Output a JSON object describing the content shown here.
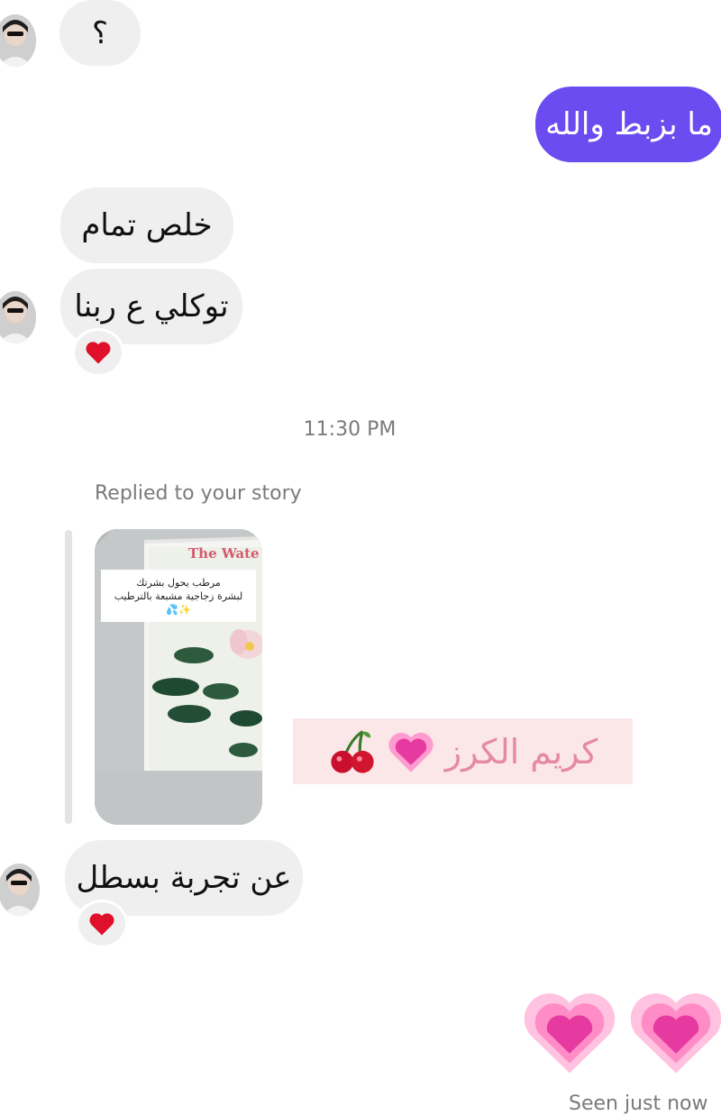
{
  "messages": {
    "question": "؟",
    "sent_reply": "ما بزبط والله",
    "khalas": "خلص تمام",
    "tawakkali": "توكلي ع ربنا",
    "an_tajriba": "عن تجربة بسطل"
  },
  "reactions": {
    "emoji": "heart"
  },
  "timestamp": "11:30 PM",
  "story_reply": {
    "label": "Replied to your story",
    "book_title": "The Wate",
    "caption_line1": "مرطب يحول بشرتك",
    "caption_line2": "لبشرة زجاجية مشبعة بالترطيب",
    "caption_line3": "✨💦",
    "banner_text": "كريم الكرز"
  },
  "sent_hearts": {
    "emoji": "growing-heart",
    "count": 2
  },
  "status": "Seen just now",
  "colors": {
    "sent_bubble": "#6a4cf0",
    "received_bubble": "#efefef",
    "heart_red": "#e0102a",
    "heart_pink": "#e63aa0",
    "meta_text": "#7a7a7a"
  }
}
